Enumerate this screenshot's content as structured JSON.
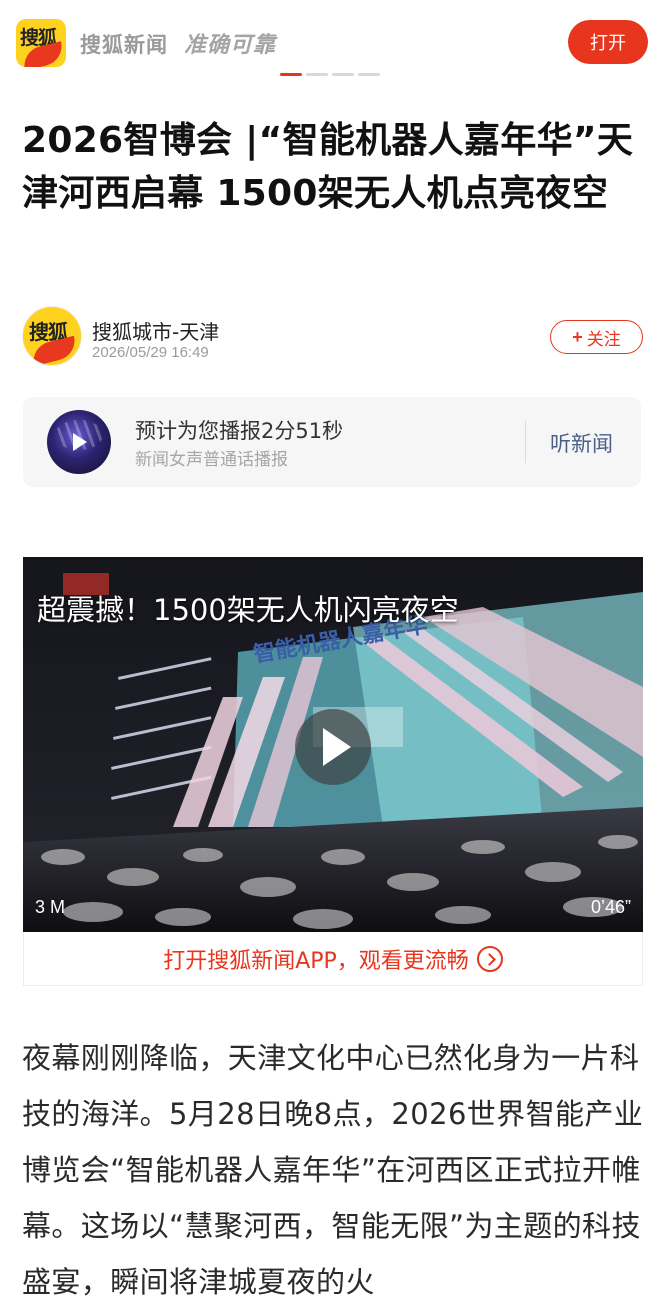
{
  "header": {
    "logo_text": "搜狐",
    "brand_name": "搜狐新闻",
    "slogan": "准确可靠",
    "open_label": "打开",
    "brand_color": "#e8361e"
  },
  "article": {
    "title": "2026智博会 |“智能机器人嘉年华”天津河西启幕 1500架无人机点亮夜空"
  },
  "author": {
    "avatar_text": "搜狐",
    "name": "搜狐城市-天津",
    "time": "2026/05/29 16:49",
    "follow_label": "关注"
  },
  "audio": {
    "title": "预计为您播报2分51秒",
    "subtitle": "新闻女声普通话播报",
    "listen_label": "听新闻"
  },
  "video": {
    "title": "超震撼！1500架无人机闪亮夜空",
    "size": "3 M",
    "duration": "0’46”",
    "cta": "打开搜狐新闻APP，观看更流畅"
  },
  "body": {
    "paragraph": "夜幕刚刚降临，天津文化中心已然化身为一片科技的海洋。5月28日晚8点，2026世界智能产业博览会“智能机器人嘉年华”在河西区正式拉开帷幕。这场以“慧聚河西，智能无限”为主题的科技盛宴，瞬间将津城夏夜的火"
  }
}
